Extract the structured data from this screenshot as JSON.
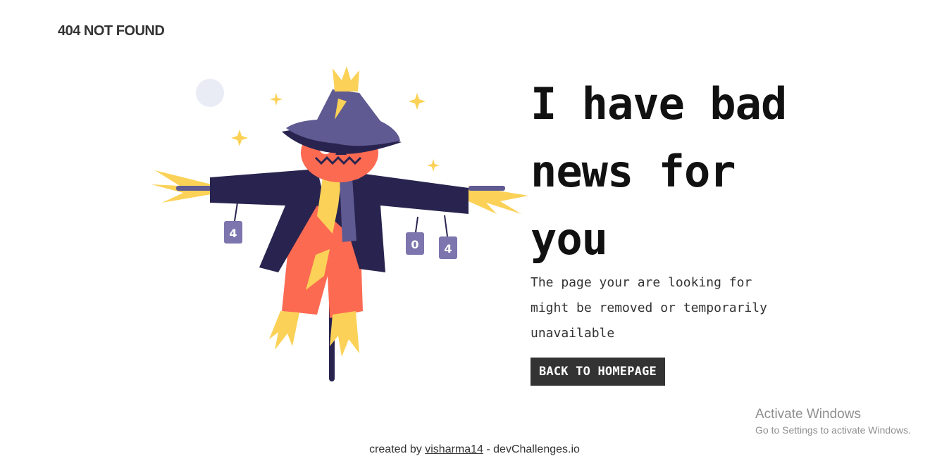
{
  "header": {
    "brand": "404 NOT FOUND"
  },
  "illustration": {
    "can_labels": [
      "4",
      "0",
      "4"
    ],
    "colors": {
      "hat": "#5f5a92",
      "coat": "#28244f",
      "face": "#fd6a52",
      "straw": "#fbd257",
      "moon": "#e9ecf5"
    }
  },
  "main": {
    "headline": "I have bad news for you",
    "message": "The page your are looking for might be removed or temporarily unavailable",
    "button_label": "BACK TO HOMEPAGE"
  },
  "footer": {
    "prefix": "created by ",
    "author": "visharma14",
    "suffix": " - devChallenges.io"
  },
  "watermark": {
    "title": "Activate Windows",
    "subtitle": "Go to Settings to activate Windows."
  }
}
